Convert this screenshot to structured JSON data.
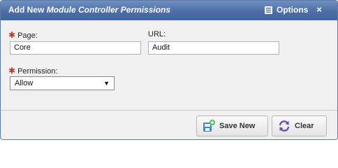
{
  "window": {
    "title_prefix": "Add New",
    "title_emphasis": "Module Controller Permissions",
    "options_label": "Options",
    "close_symbol": "×"
  },
  "form": {
    "page": {
      "label": "Page:",
      "value": "Core",
      "required": true
    },
    "url": {
      "label": "URL:",
      "value": "Audit",
      "required": false
    },
    "permission": {
      "label": "Permission:",
      "selected": "Allow",
      "required": true
    },
    "required_mark": "✱"
  },
  "buttons": {
    "save_new": {
      "label": "Save New",
      "icon": "save-new-icon"
    },
    "clear": {
      "label": "Clear",
      "icon": "refresh-icon"
    }
  },
  "colors": {
    "titlebar": "#4d6fa6",
    "required": "#c0392b",
    "panel": "#f0f0f0"
  }
}
